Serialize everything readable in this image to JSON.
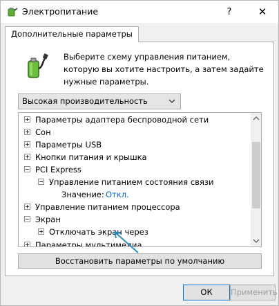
{
  "window": {
    "title": "Электропитание",
    "help_glyph": "?",
    "close_glyph": "✕"
  },
  "tab": {
    "label": "Дополнительные параметры"
  },
  "intro": {
    "text": "Выберите схему управления питанием, которую вы хотите настроить, а затем задайте нужные параметры."
  },
  "scheme": {
    "selected": "Высокая производительность"
  },
  "tree": {
    "rows": [
      {
        "label": "Параметры адаптера беспроводной сети",
        "expander": "plus"
      },
      {
        "label": "Сон",
        "expander": "plus"
      },
      {
        "label": "Параметры USB",
        "expander": "plus"
      },
      {
        "label": "Кнопки питания и крышка",
        "expander": "plus"
      },
      {
        "label": "PCI Express",
        "expander": "minus"
      },
      {
        "label": "Управление питанием состояния связи",
        "expander": "minus"
      },
      {
        "label": "Значение:",
        "value": "Откл."
      },
      {
        "label": "Управление питанием процессора",
        "expander": "plus"
      },
      {
        "label": "Экран",
        "expander": "minus"
      },
      {
        "label": "Отключать экран через",
        "expander": "plus"
      },
      {
        "label": "Параметры мультимедиа",
        "expander": "plus"
      }
    ]
  },
  "restore_button": {
    "label": "Восстановить параметры по умолчанию"
  },
  "buttons": {
    "ok": "ОК",
    "apply": "Применить"
  },
  "colors": {
    "link": "#0066cc",
    "annotation_arrow": "#2a8fc7",
    "accent_border": "#0078d7"
  }
}
